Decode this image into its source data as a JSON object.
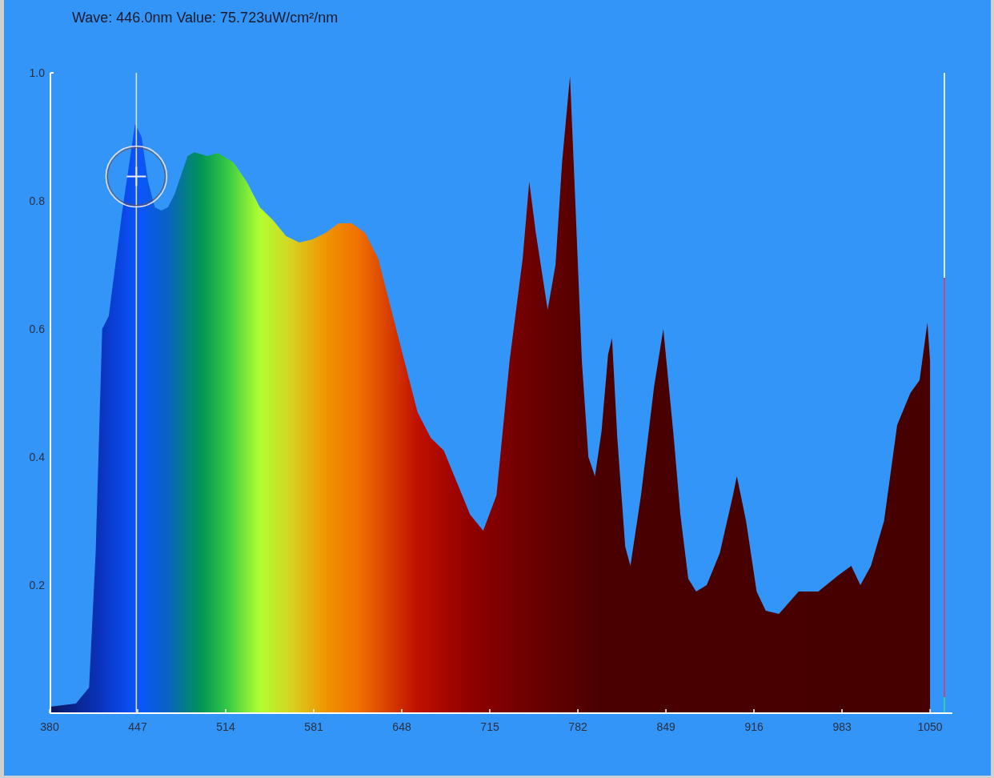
{
  "readout": "Wave: 446.0nm Value: 75.723uW/cm²/nm",
  "chart_data": {
    "type": "area",
    "xlim": [
      380,
      1067
    ],
    "ylim": [
      0,
      1
    ],
    "xticks": [
      380,
      447,
      514,
      581,
      648,
      715,
      782,
      849,
      916,
      983,
      1050
    ],
    "yticks": [
      0.2,
      0.4,
      0.6,
      0.8,
      {
        "value": 1,
        "label": "1.0"
      }
    ],
    "x": [
      380,
      400,
      410,
      415,
      420,
      425,
      430,
      435,
      440,
      445,
      450,
      455,
      460,
      465,
      470,
      475,
      480,
      485,
      490,
      500,
      508,
      520,
      530,
      540,
      550,
      560,
      570,
      580,
      590,
      600,
      610,
      620,
      630,
      640,
      650,
      660,
      670,
      680,
      690,
      700,
      710,
      720,
      730,
      740,
      745,
      750,
      759,
      765,
      770,
      776,
      780,
      785,
      790,
      795,
      800,
      805,
      808,
      812,
      818,
      822,
      830,
      840,
      847,
      855,
      860,
      866,
      872,
      880,
      890,
      900,
      903,
      910,
      918,
      925,
      935,
      950,
      965,
      980,
      990,
      997,
      1005,
      1015,
      1025,
      1035,
      1042,
      1048,
      1050
    ],
    "series": [
      {
        "values": [
          0.01,
          0.015,
          0.04,
          0.25,
          0.6,
          0.62,
          0.7,
          0.78,
          0.85,
          0.92,
          0.9,
          0.83,
          0.79,
          0.785,
          0.79,
          0.81,
          0.84,
          0.87,
          0.876,
          0.87,
          0.875,
          0.86,
          0.83,
          0.79,
          0.77,
          0.745,
          0.735,
          0.74,
          0.75,
          0.765,
          0.765,
          0.75,
          0.71,
          0.63,
          0.55,
          0.47,
          0.43,
          0.41,
          0.36,
          0.31,
          0.285,
          0.34,
          0.55,
          0.71,
          0.83,
          0.75,
          0.63,
          0.7,
          0.86,
          0.995,
          0.8,
          0.55,
          0.4,
          0.37,
          0.44,
          0.56,
          0.586,
          0.43,
          0.26,
          0.23,
          0.34,
          0.51,
          0.6,
          0.43,
          0.31,
          0.21,
          0.19,
          0.2,
          0.25,
          0.34,
          0.37,
          0.3,
          0.19,
          0.16,
          0.155,
          0.19,
          0.19,
          0.215,
          0.23,
          0.2,
          0.23,
          0.3,
          0.45,
          0.5,
          0.52,
          0.61,
          0.55
        ]
      }
    ],
    "ref_lines": [
      {
        "axis": "x",
        "value": 446
      }
    ]
  },
  "meter": {
    "level": 0.68
  }
}
